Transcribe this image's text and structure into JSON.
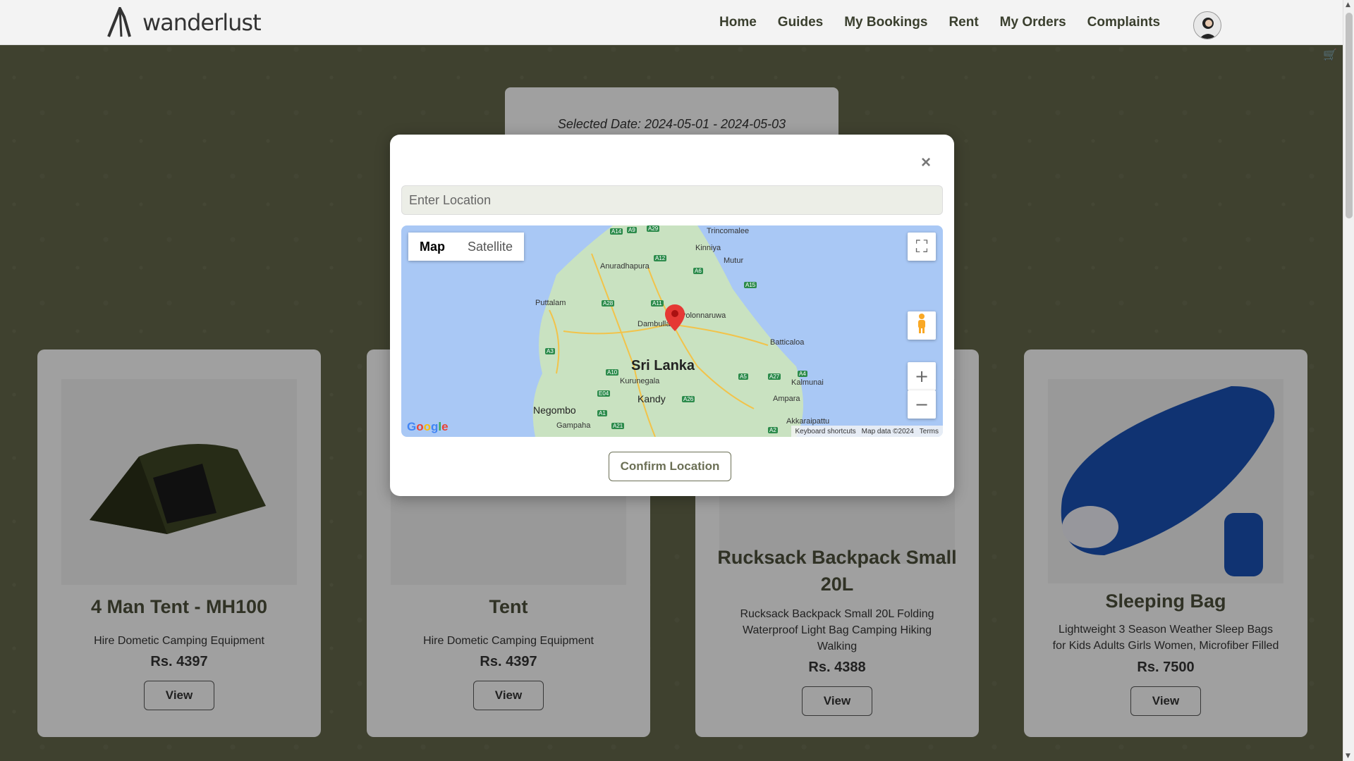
{
  "nav": {
    "brand": "wanderlust",
    "links": [
      "Home",
      "Guides",
      "My Bookings",
      "Rent",
      "My Orders",
      "Complaints"
    ]
  },
  "date_panel": {
    "text": "Selected Date: 2024-05-01 - 2024-05-03"
  },
  "products": [
    {
      "title": "4 Man Tent - MH100",
      "desc": "Hire Dometic Camping Equipment",
      "price": "Rs. 4397",
      "button": "View"
    },
    {
      "title": "Tent",
      "desc": "Hire Dometic Camping Equipment",
      "price": "Rs. 4397",
      "button": "View"
    },
    {
      "title": "Rucksack Backpack Small 20L",
      "desc": "Rucksack Backpack Small 20L Folding Waterproof Light Bag Camping Hiking Walking",
      "price": "Rs. 4388",
      "button": "View"
    },
    {
      "title": "Sleeping Bag",
      "desc": "Lightweight 3 Season Weather Sleep Bags for Kids Adults Girls Women, Microfiber Filled",
      "price": "Rs. 7500",
      "button": "View"
    }
  ],
  "modal": {
    "close": "×",
    "location_placeholder": "Enter Location",
    "map_types": [
      "Map",
      "Satellite"
    ],
    "map_labels": {
      "country": "Sri Lanka",
      "cities": [
        "Trincomalee",
        "Kinniya",
        "Mutur",
        "Anuradhapura",
        "Puttalam",
        "Dambulla",
        "Polonnaruwa",
        "Batticaloa",
        "Kurunegala",
        "Kalmunai",
        "Kandy",
        "Ampara",
        "Negombo",
        "Gampaha",
        "Akkaraipattu"
      ],
      "roads": [
        "A14",
        "A9",
        "A29",
        "A12",
        "A6",
        "A15",
        "A28",
        "A11",
        "A3",
        "A10",
        "A5",
        "A27",
        "A4",
        "E04",
        "A26",
        "A1",
        "A21",
        "A2"
      ]
    },
    "map_footer": {
      "shortcuts": "Keyboard shortcuts",
      "data": "Map data ©2024",
      "terms": "Terms"
    },
    "google": "Google",
    "confirm": "Confirm Location"
  },
  "icons": {
    "close": "close-icon",
    "fullscreen": "fullscreen-icon",
    "pegman": "pegman-icon",
    "zoom_in": "plus-icon",
    "zoom_out": "minus-icon",
    "marker": "map-marker-icon",
    "cart": "cart-icon"
  }
}
